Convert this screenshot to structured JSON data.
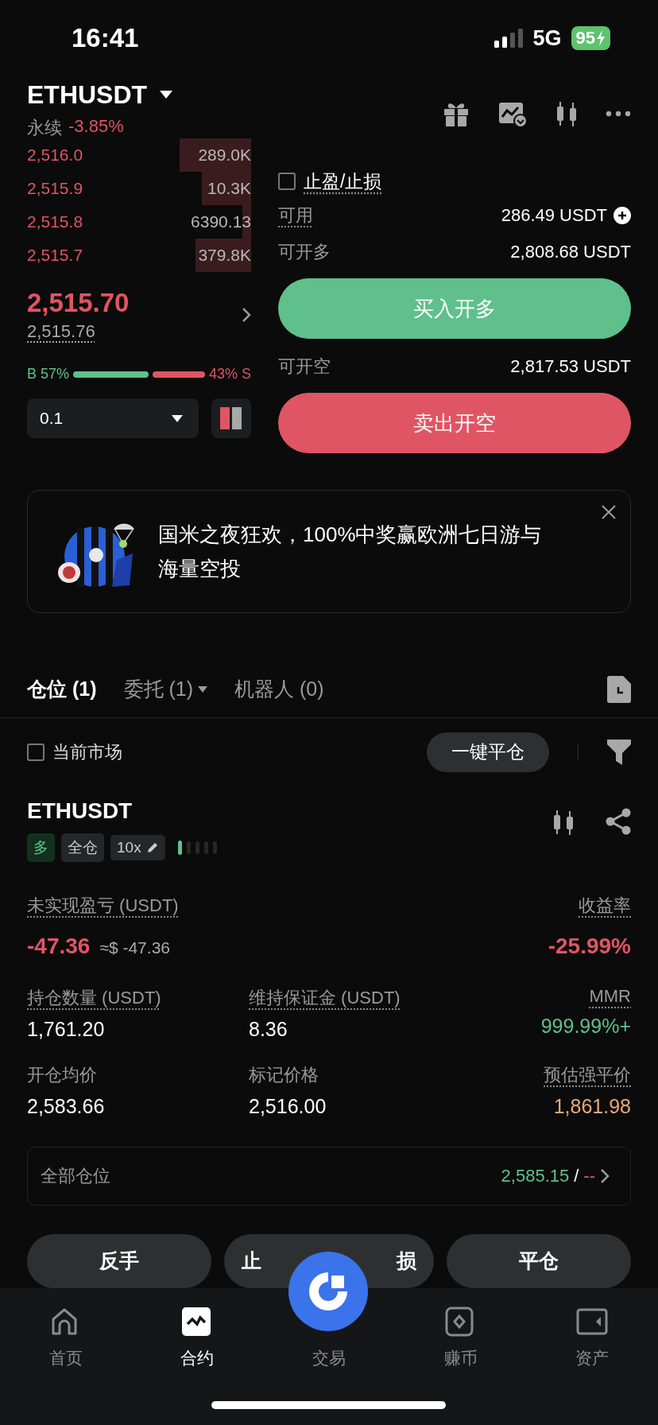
{
  "status_bar": {
    "time": "16:41",
    "network": "5G",
    "battery": "95"
  },
  "header": {
    "symbol": "ETHUSDT",
    "type": "永续",
    "change": "-3.85%"
  },
  "order_book": {
    "asks": [
      {
        "price": "2,516.0",
        "size": "289.0K"
      },
      {
        "price": "2,515.9",
        "size": "10.3K"
      },
      {
        "price": "2,515.8",
        "size": "6390.13"
      },
      {
        "price": "2,515.7",
        "size": "379.8K"
      }
    ],
    "last_price": "2,515.70",
    "mark_price": "2,515.76",
    "buy_label": "B 57%",
    "sell_label": "43% S",
    "depth_step": "0.1"
  },
  "order_form": {
    "tp_sl": {
      "label": "止盈/止损",
      "checked": false
    },
    "available": {
      "label": "可用",
      "value": "286.49 USDT"
    },
    "max_long": {
      "label": "可开多",
      "value": "2,808.68 USDT"
    },
    "buy_button": "买入开多",
    "max_short": {
      "label": "可开空",
      "value": "2,817.53 USDT"
    },
    "sell_button": "卖出开空"
  },
  "banner": {
    "kind": "picture",
    "text": "国米之夜狂欢，100%中奖赢欧洲七日游与海量空投"
  },
  "tabs": [
    {
      "label": "仓位 (1)",
      "selected": true,
      "dropdown": false
    },
    {
      "label": "委托 (1)",
      "selected": false,
      "dropdown": true
    },
    {
      "label": "机器人 (0)",
      "selected": false,
      "dropdown": false
    }
  ],
  "filter": {
    "label": "当前市场",
    "checked": false
  },
  "close_all_button": "一键平仓",
  "position": {
    "symbol": "ETHUSDT",
    "side": {
      "label": "多",
      "kind": "long"
    },
    "margin_mode": "全仓",
    "leverage": "10x",
    "pnl_label": "未实现盈亏 (USDT)",
    "pnl": "-47.36",
    "pnl_usd": "≈$ -47.36",
    "roe_label": "收益率",
    "roe": "-25.99%",
    "fields": [
      {
        "label": "持仓数量 (USDT)",
        "value": "1,761.20",
        "color": "#ffffff",
        "hint": true
      },
      {
        "label": "维持保证金 (USDT)",
        "value": "8.36",
        "color": "#ffffff",
        "hint": true
      },
      {
        "label": "MMR",
        "value": "999.99%+",
        "color": "#5fc08b",
        "hint": true
      },
      {
        "label": "开仓均价",
        "value": "2,583.66",
        "color": "#ffffff",
        "hint": false
      },
      {
        "label": "标记价格",
        "value": "2,516.00",
        "color": "#ffffff",
        "hint": false
      },
      {
        "label": "预估强平价",
        "value": "1,861.98",
        "color": "#e8a97a",
        "hint": true
      }
    ]
  },
  "summary": {
    "label": "全部仓位",
    "value": "2,585.15",
    "separator": "/",
    "pnl": "--"
  },
  "actions": [
    {
      "label": "反手"
    },
    {
      "label_parts": [
        "止",
        "损"
      ]
    },
    {
      "label": "平仓"
    }
  ],
  "nav": [
    {
      "label": "首页",
      "selected": false
    },
    {
      "label": "合约",
      "selected": true
    },
    {
      "label": "交易",
      "selected": false
    },
    {
      "label": "赚币",
      "selected": false
    },
    {
      "label": "资产",
      "selected": false
    }
  ]
}
